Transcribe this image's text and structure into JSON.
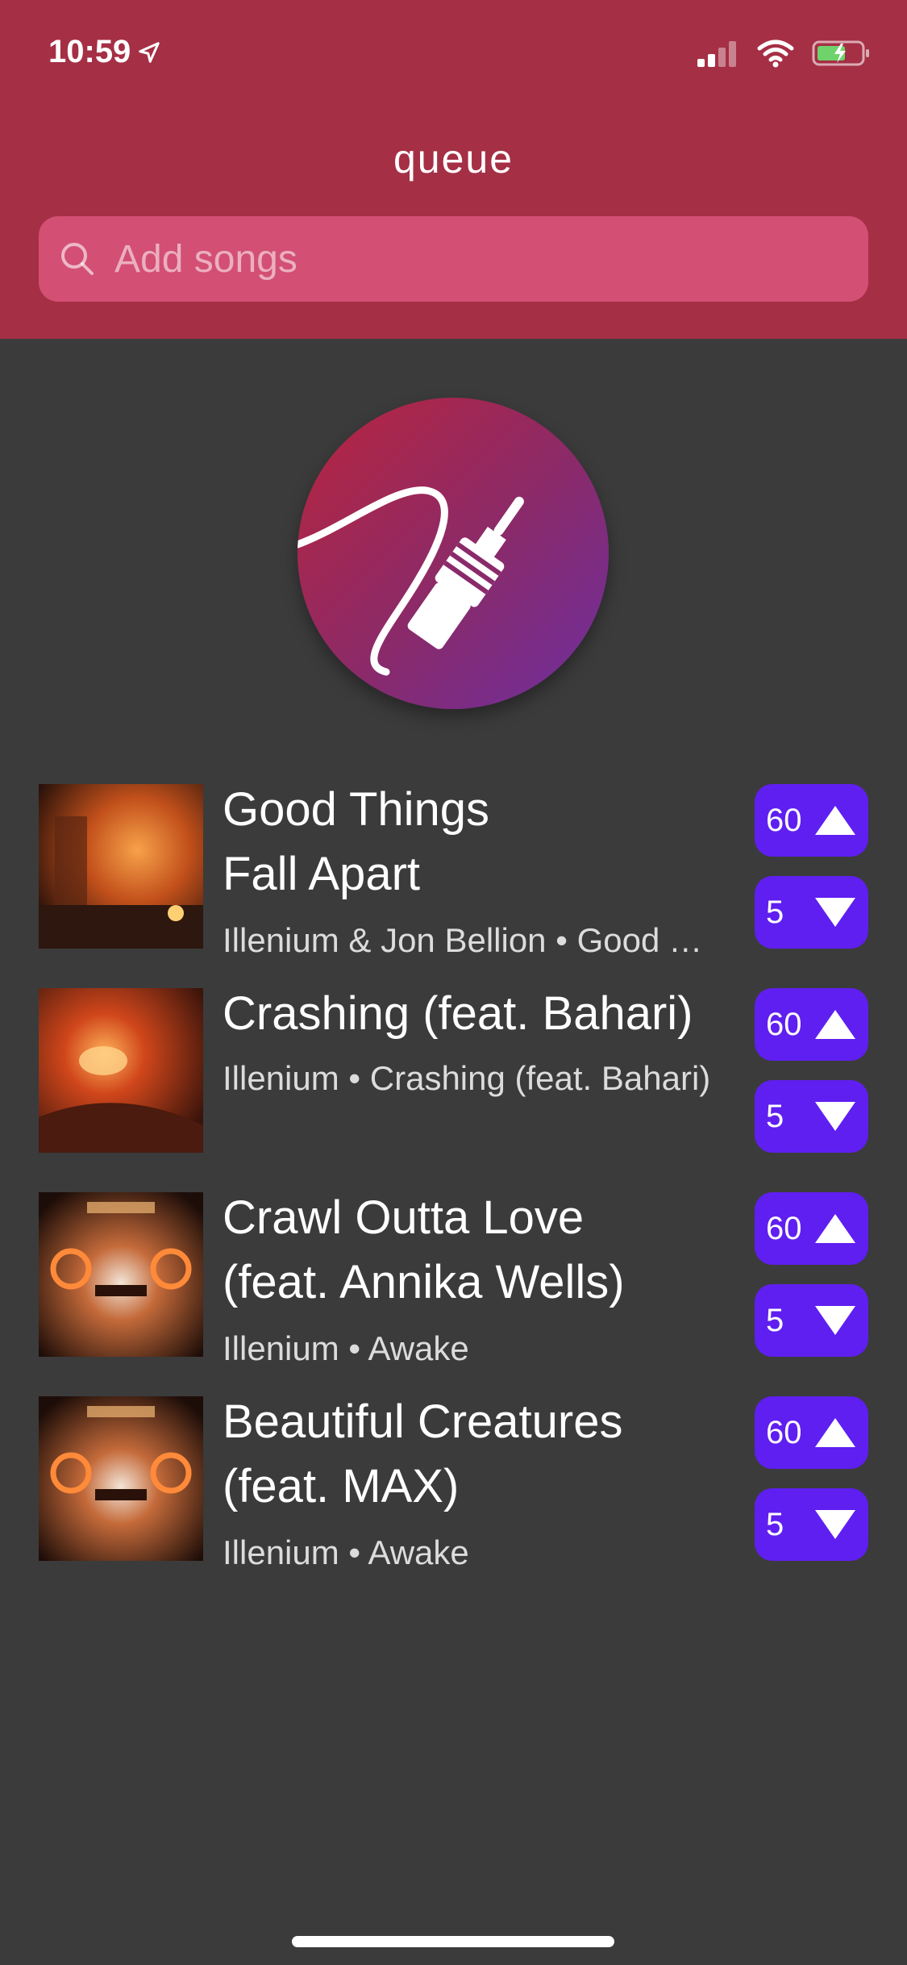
{
  "status_bar": {
    "time": "10:59"
  },
  "header": {
    "title": "queue"
  },
  "search": {
    "placeholder": "Add songs"
  },
  "songs": [
    {
      "title_line1": "Good Things",
      "title_line2": "Fall Apart",
      "meta": "Illenium & Jon Bellion • Good Things Fall Apart",
      "upvotes": "60",
      "downvotes": "5"
    },
    {
      "title_line1": "Crashing (feat. Bahari)",
      "title_line2": "",
      "meta": "Illenium • Crashing (feat. Bahari)",
      "upvotes": "60",
      "downvotes": "5"
    },
    {
      "title_line1": "Crawl Outta Love",
      "title_line2": "(feat. Annika Wells)",
      "meta": "Illenium • Awake",
      "upvotes": "60",
      "downvotes": "5"
    },
    {
      "title_line1": "Beautiful Creatures",
      "title_line2": "(feat. MAX)",
      "meta": "Illenium • Awake",
      "upvotes": "60",
      "downvotes": "5"
    }
  ],
  "colors": {
    "header": "#a52f45",
    "search": "#d34f74",
    "background": "#3b3b3b",
    "vote_button": "#5f1ff0"
  }
}
